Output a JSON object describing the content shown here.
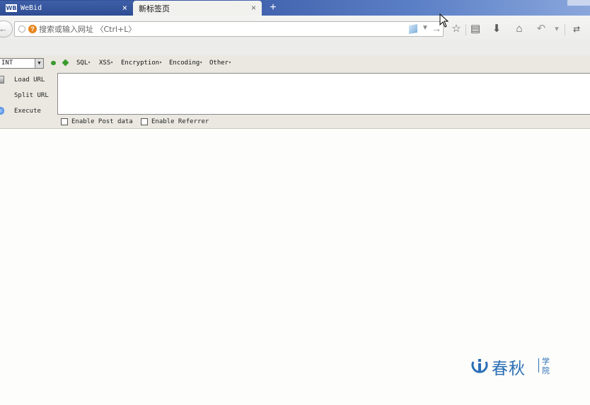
{
  "tabs": [
    {
      "favicon": "WB",
      "title": "WeBid",
      "close": "×"
    },
    {
      "title": "新标签页",
      "close": "×"
    }
  ],
  "newtab": "+",
  "navbar": {
    "back_icon": "←",
    "url_placeholder": "搜索或输入网址 〈Ctrl+L〉",
    "url_info_icon": "?",
    "dropdown_icon": "▼",
    "go_icon": "→",
    "icons": {
      "bookmark": "☆",
      "reading_list": "▤",
      "downloads": "⬇",
      "home": "⌂",
      "undo": "↶",
      "menu_drop": "▾",
      "overflow": "⇄"
    }
  },
  "hackbar": {
    "select_value": "INT",
    "select_arrow": "▼",
    "menus": [
      "SQL",
      "XSS",
      "Encryption",
      "Encoding",
      "Other"
    ],
    "menu_caret": "▾",
    "actions": {
      "load": "Load URL",
      "split": "Split URL",
      "execute": "Execute"
    },
    "textarea_value": "",
    "options": {
      "post_data": "Enable Post data",
      "referrer": "Enable Referrer"
    }
  },
  "watermark": {
    "brand": "春秋",
    "sub_top": "学",
    "sub_bottom": "院",
    "accent": "#2b6fb6"
  }
}
